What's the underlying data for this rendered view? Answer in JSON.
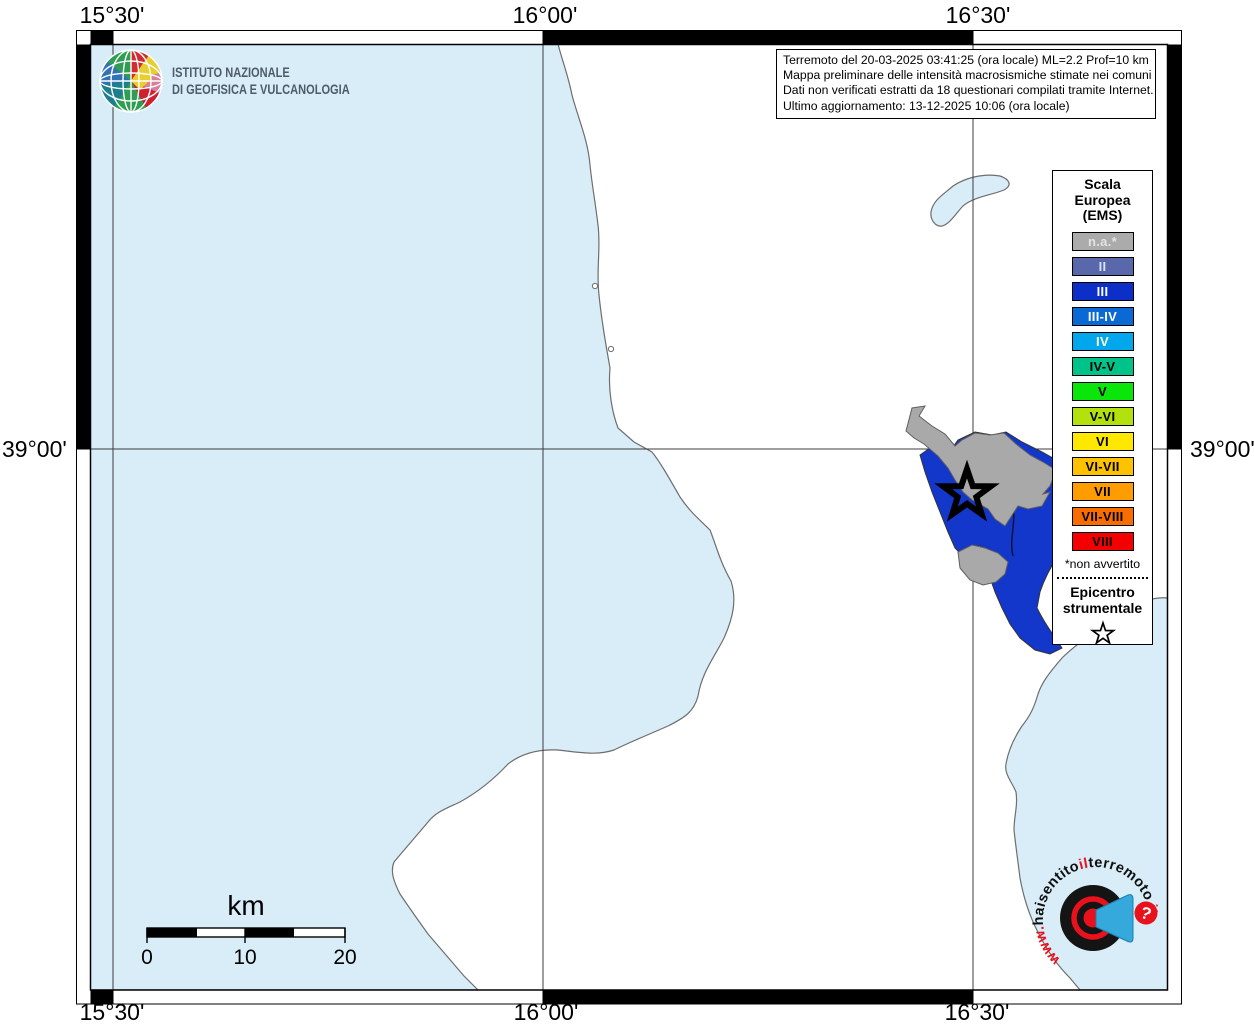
{
  "coordinates": {
    "top": [
      "15°30'",
      "16°00'",
      "16°30'"
    ],
    "bottom": [
      "15°30'",
      "16°00'",
      "16°30'"
    ],
    "left": "39°00'",
    "right": "39°00'"
  },
  "ingv_logo": {
    "line1": "ISTITUTO NAZIONALE",
    "line2": "DI GEOFISICA E VULCANOLOGIA"
  },
  "info_box": {
    "lines": [
      "Terremoto del 20-03-2025 03:41:25 (ora locale) ML=2.2 Prof=10 km",
      "Mappa preliminare delle intensità macrosismiche stimate nei comuni",
      "Dati non verificati estratti da 18 questionari compilati tramite Internet.",
      "Ultimo aggiornamento: 13-12-2025 10:06 (ora locale)"
    ]
  },
  "legend": {
    "title_lines": [
      "Scala",
      "Europea",
      "(EMS)"
    ],
    "entries": [
      {
        "label": "n.a.*",
        "color": "#ababab",
        "text_color": "#e3e3e3"
      },
      {
        "label": "II",
        "color": "#5868ab",
        "text_color": "#dbe2f4"
      },
      {
        "label": "III",
        "color": "#0c2fc8",
        "text_color": "#ffffff"
      },
      {
        "label": "III-IV",
        "color": "#0a69d2",
        "text_color": "#ffffff"
      },
      {
        "label": "IV",
        "color": "#00a7ec",
        "text_color": "#ffffff"
      },
      {
        "label": "IV-V",
        "color": "#00c389",
        "text_color": "#000000"
      },
      {
        "label": "V",
        "color": "#0ae50a",
        "text_color": "#000000"
      },
      {
        "label": "V-VI",
        "color": "#b2e10e",
        "text_color": "#000000"
      },
      {
        "label": "VI",
        "color": "#ffe800",
        "text_color": "#000000"
      },
      {
        "label": "VI-VII",
        "color": "#fcc200",
        "text_color": "#000000"
      },
      {
        "label": "VII",
        "color": "#ff9c00",
        "text_color": "#000000"
      },
      {
        "label": "VII-VIII",
        "color": "#f96d00",
        "text_color": "#000000"
      },
      {
        "label": "VIII",
        "color": "#f50000",
        "text_color": "#000000"
      }
    ],
    "footnote": "*non avvertito",
    "epicenter_lines": [
      "Epicentro",
      "strumentale"
    ]
  },
  "scale_bar": {
    "unit": "km",
    "tick_labels": [
      "0",
      "10",
      "20"
    ]
  },
  "hsit_logo": {
    "segments": [
      {
        "text": "www.",
        "color": "#e8111c"
      },
      {
        "text": "haisentito",
        "color": "#101010"
      },
      {
        "text": "il",
        "color": "#e8111c"
      },
      {
        "text": "terremoto",
        "color": "#101010"
      },
      {
        "text": ".it",
        "color": "#e8111c"
      }
    ],
    "question_mark": "?"
  },
  "map_colors": {
    "sea": "#d9edf8",
    "land": "#ffffff",
    "intensity_iii_fill": "#1336cb",
    "not_felt_fill": "#a9a9a9",
    "epicenter_star": "#000000"
  }
}
